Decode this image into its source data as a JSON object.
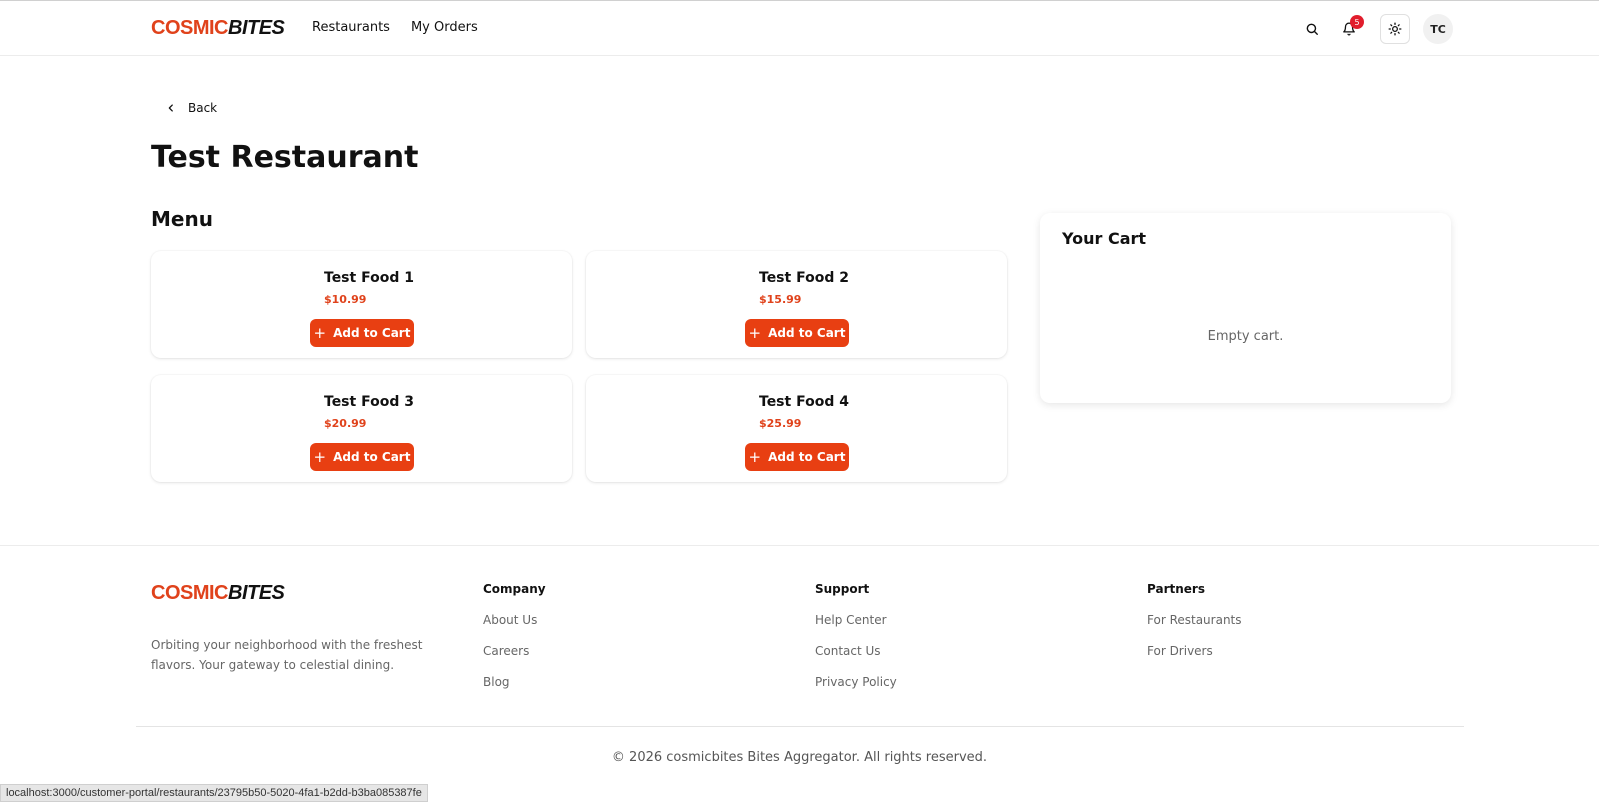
{
  "header": {
    "logo_part1": "COSMIC",
    "logo_part2": "BITES",
    "nav": [
      "Restaurants",
      "My Orders"
    ],
    "notification_count": "5",
    "avatar_initials": "TC",
    "icons": [
      "search-icon",
      "bell-icon",
      "sun-icon"
    ]
  },
  "page": {
    "back_label": "Back",
    "title": "Test Restaurant",
    "menu_title": "Menu"
  },
  "menu": {
    "add_label": "Add to Cart",
    "items": [
      {
        "name": "Test Food 1",
        "price": "$10.99"
      },
      {
        "name": "Test Food 2",
        "price": "$15.99"
      },
      {
        "name": "Test Food 3",
        "price": "$20.99"
      },
      {
        "name": "Test Food 4",
        "price": "$25.99"
      }
    ]
  },
  "cart": {
    "title": "Your Cart",
    "empty_text": "Empty cart."
  },
  "footer": {
    "logo_part1": "COSMIC",
    "logo_part2": "BITES",
    "tagline": "Orbiting your neighborhood with the freshest flavors. Your gateway to celestial dining.",
    "columns": [
      {
        "heading": "Company",
        "links": [
          "About Us",
          "Careers",
          "Blog"
        ]
      },
      {
        "heading": "Support",
        "links": [
          "Help Center",
          "Contact Us",
          "Privacy Policy"
        ]
      },
      {
        "heading": "Partners",
        "links": [
          "For Restaurants",
          "For Drivers"
        ]
      }
    ],
    "copyright": "© 2026 cosmicbites Bites Aggregator. All rights reserved."
  },
  "status_url": "localhost:3000/customer-portal/restaurants/23795b50-5020-4fa1-b2dd-b3ba085387fe",
  "colors": {
    "accent": "#e83f12",
    "badge": "#e11d2c"
  }
}
